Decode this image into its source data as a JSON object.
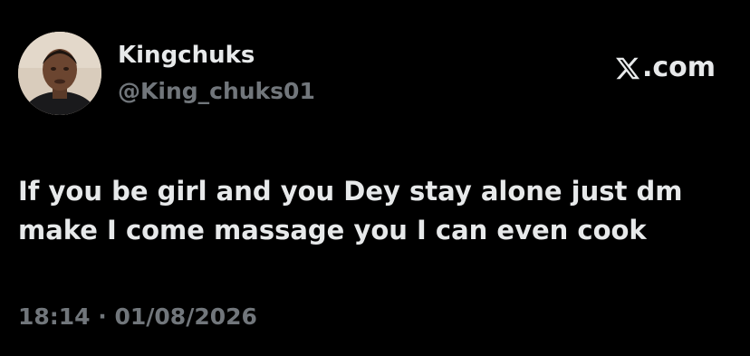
{
  "author": {
    "display_name": "Kingchuks",
    "handle": "@King_chuks01"
  },
  "brand": {
    "domain": ".com",
    "icon": "x-logo-icon"
  },
  "tweet": {
    "text": "If you be girl and you Dey stay alone just dm make I come massage you I can even cook",
    "timestamp": "18:14 · 01/08/2026"
  },
  "colors": {
    "background": "#000000",
    "primary_text": "#e7e9ea",
    "secondary_text": "#71767b"
  }
}
